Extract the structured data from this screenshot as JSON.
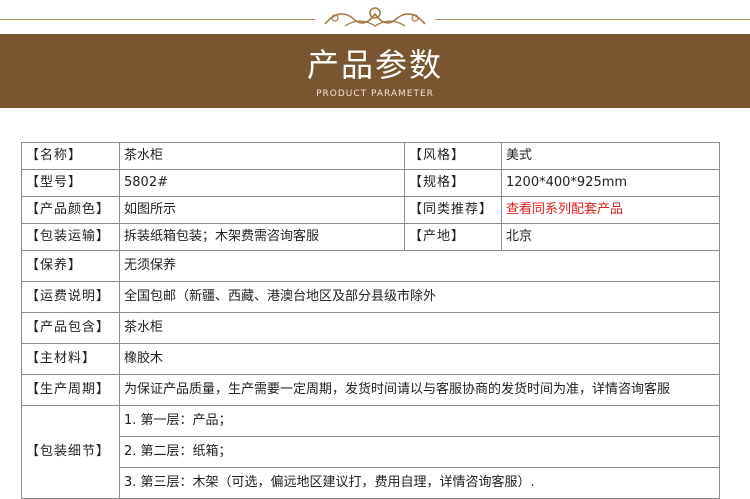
{
  "header": {
    "title": "产品参数",
    "subtitle": "PRODUCT PARAMETER"
  },
  "params": {
    "name_key": "【名称】",
    "name_val": "茶水柜",
    "style_key": "【风格】",
    "style_val": "美式",
    "model_key": "【型号】",
    "model_val": "5802#",
    "size_key": "【规格】",
    "size_val": "1200*400*925mm",
    "color_key": "【产品颜色】",
    "color_val": "如图所示",
    "related_key": "【同类推荐】",
    "related_val": "查看同系列配套产品",
    "shipping_pack_key": "【包装运输】",
    "shipping_pack_val": "拆装纸箱包装；木架费需咨询客服",
    "origin_key": "【产地】",
    "origin_val": "北京",
    "care_key": "【保养】",
    "care_val": "无须保养",
    "freight_key": "【运费说明】",
    "freight_val": "全国包邮（新疆、西藏、港澳台地区及部分县级市除外",
    "contents_key": "【产品包含】",
    "contents_val": "茶水柜",
    "material_key": "【主材料】",
    "material_val": "橡胶木",
    "cycle_key": "【生产周期】",
    "cycle_val": "为保证产品质量，生产需要一定周期，发货时间请以与客服协商的发货时间为准，详情咨询客服",
    "pack_detail_key": "【包装细节】",
    "pack_detail_items": [
      "1. 第一层：产品；",
      "2. 第二层：纸箱；",
      "3. 第三层：木架（可选，偏远地区建议打，费用自理，详情咨询客服）."
    ]
  }
}
